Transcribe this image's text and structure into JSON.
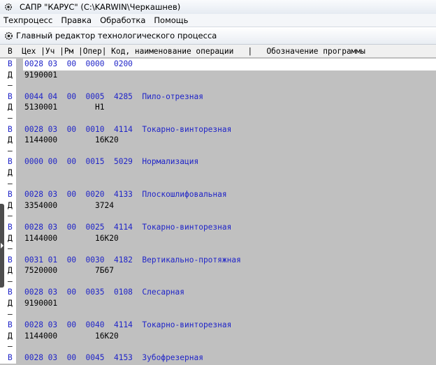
{
  "app": {
    "title": "САПР \"КАРУС\" (C:\\KARWIN\\Черкашнев)"
  },
  "menu": {
    "items": [
      "Техпроцесс",
      "Правка",
      "Обработка",
      "Помощь"
    ]
  },
  "child_window": {
    "title": "Главный редактор технологического процесса",
    "column_header": "В  Цех |Уч |Рм |Опер| Код, наименование операции   |   Обозначение программы"
  },
  "rows": [
    {
      "marker": "В",
      "text": "0028 03  00  0000  0200",
      "kind": "op",
      "selected": true
    },
    {
      "marker": "Д",
      "text": "9190001",
      "kind": "det"
    },
    {
      "marker": "–",
      "text": "",
      "kind": "sep"
    },
    {
      "marker": "В",
      "text": "0044 04  00  0005  4285  Пило-отрезная",
      "kind": "op"
    },
    {
      "marker": "Д",
      "text": "5130001        Н1",
      "kind": "det"
    },
    {
      "marker": "–",
      "text": "",
      "kind": "sep"
    },
    {
      "marker": "В",
      "text": "0028 03  00  0010  4114  Токарно-винторезная",
      "kind": "op"
    },
    {
      "marker": "Д",
      "text": "1144000        16К20",
      "kind": "det"
    },
    {
      "marker": "–",
      "text": "",
      "kind": "sep"
    },
    {
      "marker": "В",
      "text": "0000 00  00  0015  5029  Нормализация",
      "kind": "op"
    },
    {
      "marker": "Д",
      "text": "",
      "kind": "det"
    },
    {
      "marker": "–",
      "text": "",
      "kind": "sep"
    },
    {
      "marker": "В",
      "text": "0028 03  00  0020  4133  Плоскошлифовальная",
      "kind": "op"
    },
    {
      "marker": "Д",
      "text": "3354000        3724",
      "kind": "det"
    },
    {
      "marker": "–",
      "text": "",
      "kind": "sep"
    },
    {
      "marker": "В",
      "text": "0028 03  00  0025  4114  Токарно-винторезная",
      "kind": "op"
    },
    {
      "marker": "Д",
      "text": "1144000        16К20",
      "kind": "det"
    },
    {
      "marker": "–",
      "text": "",
      "kind": "sep"
    },
    {
      "marker": "В",
      "text": "0031 01  00  0030  4182  Вертикально-протяжная",
      "kind": "op"
    },
    {
      "marker": "Д",
      "text": "7520000        7Б67",
      "kind": "det"
    },
    {
      "marker": "–",
      "text": "",
      "kind": "sep"
    },
    {
      "marker": "В",
      "text": "0028 03  00  0035  0108  Слесарная",
      "kind": "op"
    },
    {
      "marker": "Д",
      "text": "9190001",
      "kind": "det"
    },
    {
      "marker": "–",
      "text": "",
      "kind": "sep"
    },
    {
      "marker": "В",
      "text": "0028 03  00  0040  4114  Токарно-винторезная",
      "kind": "op"
    },
    {
      "marker": "Д",
      "text": "1144000        16К20",
      "kind": "det"
    },
    {
      "marker": "–",
      "text": "",
      "kind": "sep"
    },
    {
      "marker": "В",
      "text": "0028 03  00  0045  4153  Зубофрезерная",
      "kind": "op"
    }
  ]
}
